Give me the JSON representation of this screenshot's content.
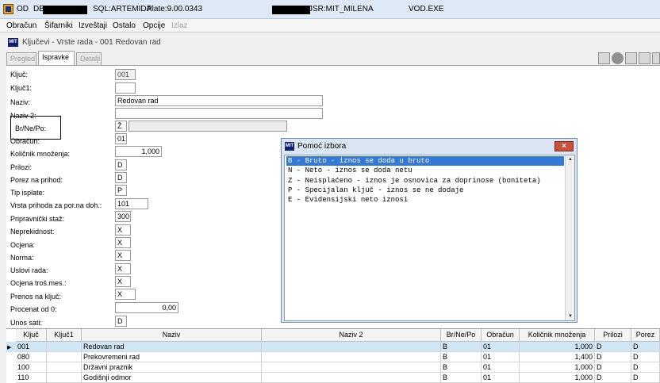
{
  "titlebar": {
    "app": "OD",
    "db_prefix": "DB",
    "sql": "SQL:ARTEMIDA",
    "plate": "Plate:9.00.0343",
    "user": "JSR:MIT_MILENA",
    "exe": "VOD.EXE"
  },
  "menu": [
    "Obračun",
    "Šifarniki",
    "Izveštaji",
    "Ostalo",
    "Opcije",
    "Izlaz"
  ],
  "document_title": "Ključevi - Vrste rada - 001 Redovan rad",
  "tabs": [
    "Pregled",
    "Ispravke",
    "Detalji"
  ],
  "form": {
    "kljuc": {
      "label": "Ključ:",
      "value": "001"
    },
    "kljuc1": {
      "label": "Ključ1:",
      "value": ""
    },
    "naziv": {
      "label": "Naziv:",
      "value": "Redovan rad"
    },
    "naziv2": {
      "label": "Naziv 2:",
      "value": ""
    },
    "brnepo": {
      "label": "Br/Ne/Po:",
      "value": "Ž"
    },
    "obracun": {
      "label": "Obračun:",
      "value": "01"
    },
    "kolicnik": {
      "label": "Količnik množenja:",
      "value": "1,000"
    },
    "prilozi": {
      "label": "Prilozi:",
      "value": "D"
    },
    "porez": {
      "label": "Porez na prihod:",
      "value": "D"
    },
    "tip_isplate": {
      "label": "Tip isplate:",
      "value": "P"
    },
    "vrsta_prihoda": {
      "label": "Vrsta prihoda za por.na doh.:",
      "value": "101"
    },
    "pripravnicki": {
      "label": "Pripravnički staž:",
      "value": "300"
    },
    "neprekidnost": {
      "label": "Neprekidnost:",
      "value": "X"
    },
    "ocjena": {
      "label": "Ocjena:",
      "value": "X"
    },
    "norma": {
      "label": "Norma:",
      "value": "X"
    },
    "uslovi": {
      "label": "Uslovi rada:",
      "value": "X"
    },
    "ocjena_tros": {
      "label": "Ocjena troš.mes.:",
      "value": "X"
    },
    "prenos": {
      "label": "Prenos na ključ:",
      "value": "X"
    },
    "procenat": {
      "label": "Procenat od 0:",
      "value": "0,00"
    },
    "unos_sati": {
      "label": "Unos sati:",
      "value": "D"
    }
  },
  "popup": {
    "title": "Pomoć izbora",
    "items": [
      "B - Bruto - iznos se doda u bruto",
      "N - Neto - iznos se doda netu",
      "Z - Neisplaćeno - iznos je osnovica za doprinose (boniteta)",
      "P - Specijalan ključ - iznos se ne dodaje",
      "E - Evidensijski neto iznosi"
    ],
    "selected_index": 0
  },
  "grid": {
    "columns": [
      "Ključ",
      "Ključ1",
      "Naziv",
      "Naziv 2",
      "Br/Ne/Po",
      "Obračun",
      "Količnik množenja",
      "Prilozi",
      "Porez"
    ],
    "rows": [
      [
        "001",
        "",
        "Redovan rad",
        "",
        "B",
        "01",
        "1,000",
        "D",
        "D"
      ],
      [
        "080",
        "",
        "Prekovremeni rad",
        "",
        "B",
        "01",
        "1,400",
        "D",
        "D"
      ],
      [
        "100",
        "",
        "Državni praznik",
        "",
        "B",
        "01",
        "1,000",
        "D",
        "D"
      ],
      [
        "110",
        "",
        "Godišnji odmor",
        "",
        "B",
        "01",
        "1,000",
        "D",
        "D"
      ]
    ],
    "selected_row": 0
  }
}
